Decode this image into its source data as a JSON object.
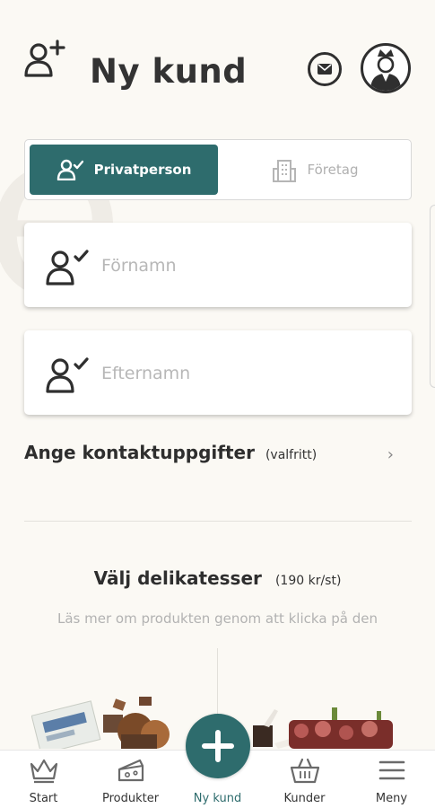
{
  "header": {
    "title": "Ny kund"
  },
  "customer_type": {
    "options": [
      {
        "label": "Privatperson",
        "icon": "person-check-icon",
        "selected": true
      },
      {
        "label": "Företag",
        "icon": "building-icon",
        "selected": false
      }
    ]
  },
  "form": {
    "first_name": {
      "value": "",
      "placeholder": "Förnamn"
    },
    "last_name": {
      "value": "",
      "placeholder": "Efternamn"
    }
  },
  "contact": {
    "label": "Ange kontaktuppgifter",
    "optional": "(valfritt)"
  },
  "products": {
    "title": "Välj delikatesser",
    "price": "(190 kr/st)",
    "hint": "Läs mer om produkten genom att klicka på den"
  },
  "tabbar": {
    "items": [
      {
        "label": "Start",
        "icon": "crown-icon"
      },
      {
        "label": "Produkter",
        "icon": "cheese-icon"
      },
      {
        "label": "Ny kund",
        "icon": "plus-icon",
        "active": true
      },
      {
        "label": "Kunder",
        "icon": "basket-icon"
      },
      {
        "label": "Meny",
        "icon": "menu-icon"
      }
    ]
  },
  "colors": {
    "accent": "#2e6c6d",
    "background": "#fbf9f4",
    "text": "#2b2b2b",
    "muted": "#b2b2b2"
  }
}
